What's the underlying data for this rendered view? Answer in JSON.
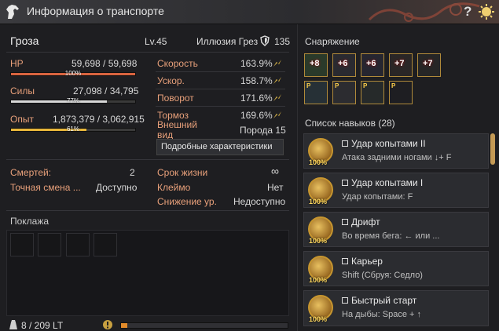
{
  "window": {
    "title": "Информация о транспорте",
    "help": "?"
  },
  "horse": {
    "name": "Гроза",
    "level": "Lv.45",
    "illusion_label": "Иллюзия Грез",
    "illusion_value": "135"
  },
  "bars": {
    "hp": {
      "label": "HP",
      "value": "59,698 / 59,698",
      "pct": "100%",
      "fraction": 1.0,
      "color": "#d9643f"
    },
    "stamina": {
      "label": "Силы",
      "value": "27,098 / 34,795",
      "pct": "77%",
      "fraction": 0.77,
      "color": "#d8d8d8"
    },
    "exp": {
      "label": "Опыт",
      "value": "1,873,379 / 3,062,915",
      "pct": "61%",
      "fraction": 0.61,
      "color": "#e8b63a"
    }
  },
  "stats": [
    {
      "label": "Скорость",
      "value": "163.9%"
    },
    {
      "label": "Ускор.",
      "value": "158.7%"
    },
    {
      "label": "Поворот",
      "value": "171.6%"
    },
    {
      "label": "Тормоз",
      "value": "169.6%"
    }
  ],
  "appearance": {
    "label_1": "Внешний",
    "label_2": "вид",
    "value": "Порода 15"
  },
  "tooltip": "Подробные характеристики",
  "info_left": [
    {
      "label": "Смертей:",
      "value": "2"
    },
    {
      "label": "Точная смена ...",
      "value": "Доступно"
    }
  ],
  "info_right": [
    {
      "label": "Срок жизни",
      "value": "∞"
    },
    {
      "label": "Клеймо",
      "value": "Нет"
    },
    {
      "label": "Снижение ур.",
      "value": "Недоступно"
    }
  ],
  "cargo": {
    "title": "Поклажа",
    "weight": "8 / 209 LT"
  },
  "equipment": {
    "title": "Снаряжение",
    "top": [
      "+8",
      "+6",
      "+6",
      "+7",
      "+7"
    ],
    "bottom": [
      "P",
      "P",
      "P",
      "P",
      "P"
    ]
  },
  "skills": {
    "title": "Список навыков (28)",
    "items": [
      {
        "name": "Удар копытами II",
        "desc": "Атака задними ногами ↓+ F",
        "pct": "100%"
      },
      {
        "name": "Удар копытами I",
        "desc": "Удар копытами: F",
        "pct": "100%"
      },
      {
        "name": "Дрифт",
        "desc": "Во время бега: ← или ...",
        "pct": "100%"
      },
      {
        "name": "Карьер",
        "desc": "Shift (Сбруя: Седло)",
        "pct": "100%"
      },
      {
        "name": "Быстрый старт",
        "desc": "На дыбы: Space + ↑",
        "pct": "100%"
      }
    ]
  }
}
